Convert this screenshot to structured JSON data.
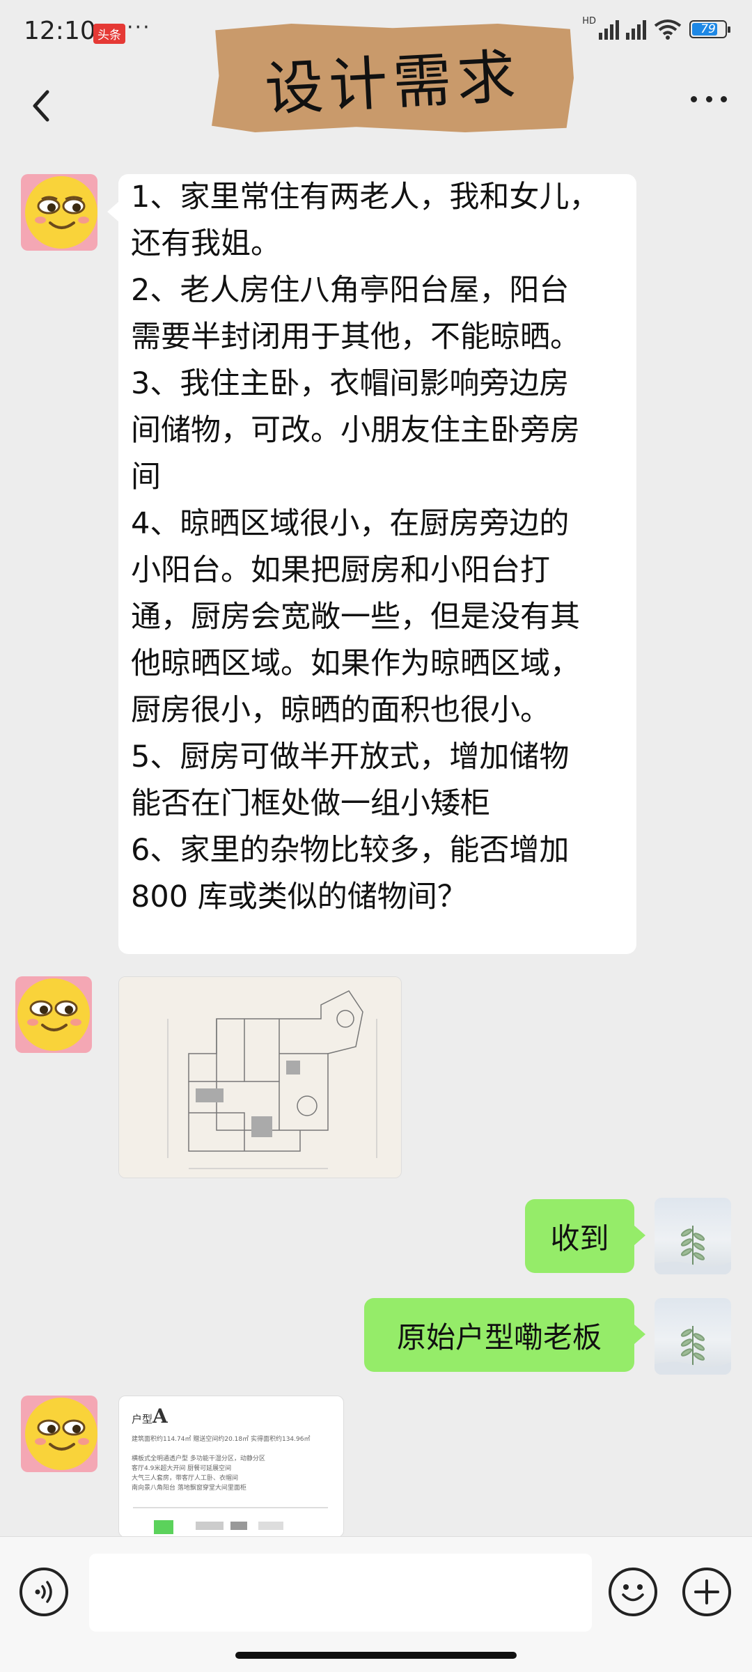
{
  "status_bar": {
    "time": "12:10",
    "app_badge": "头条",
    "more": "···",
    "hd": "HD",
    "battery_level": 79,
    "battery_text": "79",
    "icons": [
      "signal-icon",
      "wifi-icon",
      "battery-icon"
    ]
  },
  "header": {
    "title": "设计需求",
    "back_icon": "chevron-left-icon",
    "more_icon": "more-horizontal-icon"
  },
  "messages": {
    "first": {
      "sender": "left",
      "lines": [
        "1、家里常住有两老人，我和女儿，",
        "还有我姐。",
        "2、老人房住八角亭阳台屋，阳台",
        "需要半封闭用于其他，不能晾晒。",
        "3、我住主卧，衣帽间影响旁边房",
        "间储物，可改。小朋友住主卧旁房",
        "间",
        "4、晾晒区域很小，在厨房旁边的",
        "小阳台。如果把厨房和小阳台打",
        "通，厨房会宽敞一些，但是没有其",
        "他晾晒区域。如果作为晾晒区域，",
        "厨房很小，晾晒的面积也很小。",
        "5、厨房可做半开放式，增加储物",
        "能否在门框处做一组小矮柜",
        "6、家里的杂物比较多，能否增加",
        "800 库或类似的储物间？"
      ]
    },
    "floorplan_image": {
      "sender": "left",
      "type": "image",
      "description_icon": "floor-plan-image"
    },
    "reply_1": {
      "sender": "right",
      "text": "收到"
    },
    "reply_2": {
      "sender": "right",
      "text": "原始户型嘞老板"
    },
    "brochure": {
      "sender": "left",
      "type": "image",
      "title_prefix": "户型",
      "title_letter": "A",
      "lines": [
        "建筑面积约114.74㎡ 赠送空间约20.18㎡ 实得面积约134.96㎡",
        "横板式全明通透户型  多功能干湿分区，动静分区",
        "客厅4.9米超大开间  厨餐可延展空间",
        "大气三人套房，带客厅人工卧、衣帽间",
        "南向景八角阳台  落地飘窗穿堂大间里面柜"
      ]
    }
  },
  "input_bar": {
    "voice_icon": "voice-icon",
    "emoji_icon": "emoji-icon",
    "add_icon": "plus-circle-icon",
    "placeholder": ""
  },
  "colors": {
    "background": "#ededed",
    "bubble_right": "#95ec69",
    "bubble_left": "#ffffff",
    "title_banner": "#c99a6b",
    "battery": "#1e88e5"
  }
}
